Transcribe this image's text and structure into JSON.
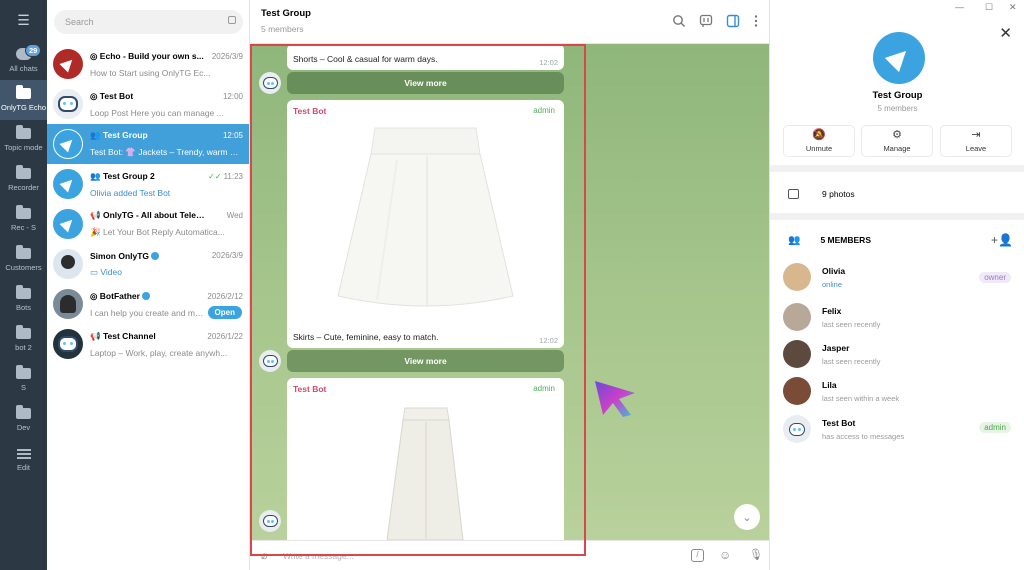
{
  "window": {
    "minimize": "—",
    "maximize": "☐",
    "close": "✕"
  },
  "rail": {
    "menu_icon": "menu-icon",
    "badge": "29",
    "folders": [
      {
        "label": "All chats",
        "icon": "chat-bubble-icon"
      },
      {
        "label": "OnlyTG Echo",
        "icon": "folder-icon"
      },
      {
        "label": "Topic mode",
        "icon": "folder-icon"
      },
      {
        "label": "Recorder",
        "icon": "folder-icon"
      },
      {
        "label": "Rec - S",
        "icon": "folder-icon"
      },
      {
        "label": "Customers",
        "icon": "folder-icon"
      },
      {
        "label": "Bots",
        "icon": "folder-icon"
      },
      {
        "label": "bot 2",
        "icon": "folder-icon"
      },
      {
        "label": "S",
        "icon": "folder-icon"
      },
      {
        "label": "Dev",
        "icon": "folder-icon"
      },
      {
        "label": "Edit",
        "icon": "sliders-icon"
      }
    ]
  },
  "search": {
    "placeholder": "Search"
  },
  "chats": [
    {
      "name": "Echo - Build your own s...",
      "time": "2026/3/9",
      "preview": "How to Start using OnlyTG Ec...",
      "prefix": "◎"
    },
    {
      "name": "Test Bot",
      "time": "12:00",
      "preview": "Loop Post  Here you can manage ...",
      "prefix": "◎"
    },
    {
      "name": "Test Group",
      "time": "12:05",
      "preview": "Test Bot: 👚 Jackets – Trendy, warm &...",
      "prefix": "👥"
    },
    {
      "name": "Test Group 2",
      "time": "11:23",
      "preview": "Olivia added Test Bot",
      "prefix": "👥"
    },
    {
      "name": "OnlyTG - All about Telegram",
      "time": "Wed",
      "preview": "🎉 Let Your Bot Reply Automatica...",
      "prefix": "📢"
    },
    {
      "name": "Simon OnlyTG",
      "time": "2026/3/9",
      "preview": "Video",
      "prefix": ""
    },
    {
      "name": "BotFather",
      "time": "2026/2/12",
      "preview": "I can help you create and ma...",
      "prefix": "◎",
      "pill": "Open"
    },
    {
      "name": "Test Channel",
      "time": "2026/1/22",
      "preview": "Laptop – Work, play, create anywh...",
      "prefix": "📢"
    }
  ],
  "chat": {
    "title": "Test Group",
    "subtitle": "5 members",
    "input_placeholder": "Write a message...",
    "messages": [
      {
        "caption": "Shorts – Cool & casual for warm days.",
        "time": "12:02",
        "button": "View more"
      },
      {
        "sender": "Test Bot",
        "tag": "admin",
        "caption": "Skirts – Cute, feminine, easy to match.",
        "time": "12:02",
        "button": "View more"
      },
      {
        "sender": "Test Bot",
        "tag": "admin"
      }
    ]
  },
  "info": {
    "name": "Test Group",
    "subtitle": "5 members",
    "actions": [
      {
        "label": "Unmute",
        "icon": "bell-off-icon"
      },
      {
        "label": "Manage",
        "icon": "sliders-icon"
      },
      {
        "label": "Leave",
        "icon": "leave-icon"
      }
    ],
    "photos_label": "9 photos",
    "members_label": "5 MEMBERS",
    "members": [
      {
        "name": "Olivia",
        "status": "online",
        "role": "owner",
        "color": "#d8b68e"
      },
      {
        "name": "Felix",
        "status": "last seen recently",
        "role": "",
        "color": "#b8a898"
      },
      {
        "name": "Jasper",
        "status": "last seen recently",
        "role": "",
        "color": "#5d4a3e"
      },
      {
        "name": "Lila",
        "status": "last seen within a week",
        "role": "",
        "color": "#7a4b36"
      },
      {
        "name": "Test Bot",
        "status": "has access to messages",
        "role": "admin",
        "color": "#e8edf2"
      }
    ]
  },
  "colors": {
    "accent": "#419fd9",
    "rail": "#2c3843",
    "chat_bg": "#a3c48a",
    "highlight_box": "#d9474d"
  }
}
